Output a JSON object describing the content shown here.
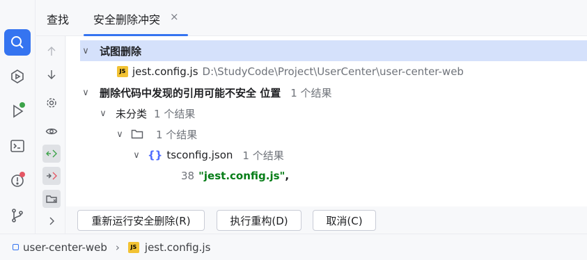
{
  "left_toolbar": {
    "items": [
      {
        "icon": "search-icon",
        "active": true
      },
      {
        "icon": "services-icon"
      },
      {
        "icon": "run-icon",
        "badge_color": "#3da34a"
      },
      {
        "icon": "terminal-icon"
      },
      {
        "icon": "problems-icon",
        "badge_color": "#e55765"
      },
      {
        "icon": "git-icon"
      }
    ]
  },
  "tabs": {
    "find_label": "查找",
    "active_label": "安全删除冲突",
    "close_glyph": "×"
  },
  "tree": {
    "rows": [
      {
        "label": "试图删除"
      },
      {
        "file": "jest.config.js",
        "file_badge": "JS",
        "path": "D:\\StudyCode\\Project\\UserCenter\\user-center-web"
      },
      {
        "label": "删除代码中发现的引用可能不安全 位置",
        "count": "1 个结果"
      },
      {
        "label": "未分类",
        "count": "1 个结果"
      },
      {
        "count": "1 个结果"
      },
      {
        "icon_text": "{}",
        "file": "tsconfig.json",
        "count": "1 个结果"
      },
      {
        "line_number": "38",
        "code": "\"jest.config.js\"",
        "suffix": ","
      }
    ]
  },
  "buttons": {
    "rerun": "重新运行安全删除(R)",
    "refactor": "执行重构(D)",
    "cancel": "取消(C)"
  },
  "statusbar": {
    "project": "user-center-web",
    "file_badge": "JS",
    "file": "jest.config.js"
  },
  "colors": {
    "accent": "#3574f0",
    "selection": "#d5e1fb",
    "string": "#067d17"
  }
}
